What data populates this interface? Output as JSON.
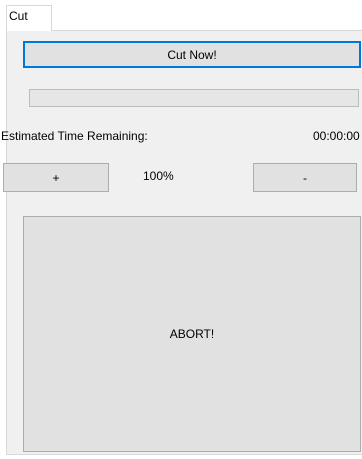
{
  "tab": {
    "label": "Cut"
  },
  "cut_button": {
    "label": "Cut Now!"
  },
  "progress": {
    "value": 0
  },
  "time_remaining": {
    "label": "Estimated Time Remaining:",
    "value": "00:00:00"
  },
  "speed": {
    "plus_label": "+",
    "value": "100%",
    "minus_label": "-"
  },
  "abort_button": {
    "label": "ABORT!"
  }
}
